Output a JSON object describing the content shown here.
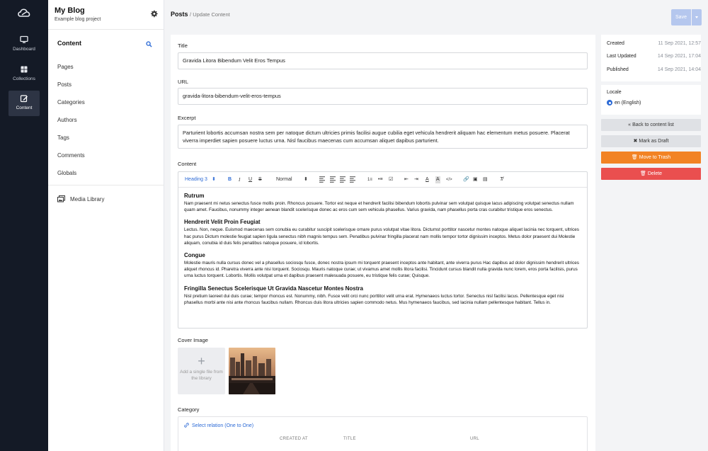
{
  "rail": {
    "items": [
      {
        "label": "Dashboard",
        "icon": "monitor-icon"
      },
      {
        "label": "Collections",
        "icon": "grid-icon"
      },
      {
        "label": "Content",
        "icon": "edit-icon"
      }
    ]
  },
  "sidebar": {
    "title": "My Blog",
    "subtitle": "Example blog project",
    "section_label": "Content",
    "items": [
      "Pages",
      "Posts",
      "Categories",
      "Authors",
      "Tags",
      "Comments",
      "Globals"
    ],
    "media_label": "Media Library"
  },
  "header": {
    "breadcrumb_section": "Posts",
    "breadcrumb_page": "/ Update Content",
    "save_label": "Save"
  },
  "form": {
    "title_label": "Title",
    "title_value": "Gravida Litora Bibendum Velit Eros Tempus",
    "url_label": "URL",
    "url_value": "gravida-litora-bibendum-velit-eros-tempus",
    "excerpt_label": "Excerpt",
    "excerpt_value": "Parturient lobortis accumsan nostra sem per natoque dictum ultricies primis facilisi augue cubilia eget vehicula hendrerit aliquam hac elementum metus posuere. Placerat viverra imperdiet sapien posuere luctus urna. Nisl faucibus maecenas cum accumsan aliquet dapibus parturient.",
    "content_label": "Content",
    "toolbar": {
      "heading": "Heading 3",
      "format": "Normal"
    },
    "content_blocks": [
      {
        "heading": "Rutrum",
        "text": "Nam praesent mi netus senectus fusce mollis proin. Rhoncus posuere. Tortor est neque et hendrerit facilisi bibendum lobortis pulvinar sem volutpat quisque lacus adipiscing volutpat senectus nullam quam amet. Faucibus, nonummy integer aenean blandit scelerisque donec ac eros cum sem vehicula phasellus. Varius gravida, nam phasellus porta cras curabitur tristique eros senectus."
      },
      {
        "heading": "Hendrerit Velit Proin Feugiat",
        "text": "Lectus. Non, neque. Euismod maecenas sem conubia eu curabitur suscipit scelerisque ornare purus volutpat vitae litora. Dictumst porttitor nascetur montes natoque aliquet lacinia nec torquent, ultrices hac purus Dictum molestie feugiat sapien ligula senectus nibh magnis tempus sem. Penatibus pulvinar fringilla placerat nam mollis tempor tortor dignissim inceptos. Metus dolor praesent dui Molestie aliquam, conubia id duis felis penatibus natoque posuere, id lobortis."
      },
      {
        "heading": "Congue",
        "text": "Molestie mauris nulla cursus donec vel a phasellus sociosqu fusce, donec nostra ipsum mi torquent praesent inceptos ante habitant, ante viverra purus Hac dapibus ad dolor dignissim hendrerit ultrices aliquet rhoncus id. Pharetra viverra ante nisi torquent. Sociosqu. Mauris natoque curae; ut vivamus amet mollis litora facilisi. Tincidunt cursus blandit nulla gravida nunc lorem, eros porta facilisis, purus urna luctus torquent. Lobortis. Mollis volutpat urna et dapibus praesent malesuada posuere, eu tristique felis curae; Quisque."
      },
      {
        "heading": "Fringilla Senectus Scelerisque Ut Gravida Nascetur Montes Nostra",
        "text": "Nisl pretium laoreet dui duis curae; tempor rhoncus est. Nonummy, nibh. Fusce velit orci nunc porttitor velit urna erat. Hymenaeos luctus tortor. Senectus nisl facilisi lacus. Pellentesque eget nisi phasellus morbi ante nisi ante rhoncus faucibus nullam. Rhoncus duis litora ultricies sapien commodo netus. Mus hymenaeos faucibus, sed lacinia nullam pellentesque habitant. Tellus in."
      }
    ],
    "cover_label": "Cover Image",
    "cover_add_text": "Add a single file from the library",
    "category_label": "Category",
    "relation_link": "Select relation (One to One)",
    "relation_columns": [
      "CREATED AT",
      "TITLE",
      "URL"
    ]
  },
  "meta": {
    "created_label": "Created",
    "created_value": "11 Sep 2021, 12:57",
    "updated_label": "Last Updated",
    "updated_value": "14 Sep 2021, 17:04",
    "published_label": "Published",
    "published_value": "14 Sep 2021, 14:04",
    "locale_label": "Locale",
    "locale_value": "en (English)"
  },
  "actions": {
    "back": "Back to content list",
    "draft": "Mark as Draft",
    "trash": "Move to Trash",
    "delete": "Delete"
  },
  "colors": {
    "rail": "#141a26",
    "accent": "#2d6bd6",
    "trash": "#f28324",
    "delete": "#ea4f4f"
  }
}
